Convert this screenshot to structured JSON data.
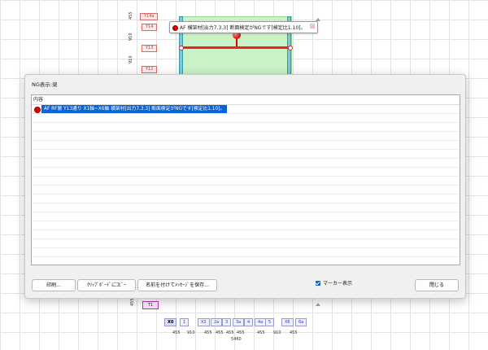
{
  "drawing": {
    "y_tags": [
      "Y14a",
      "Y14",
      "Y13",
      "Y12"
    ],
    "y_dims": [
      "910",
      "910"
    ],
    "left_dim": "455",
    "t1_label": "T1",
    "x_tags": [
      "X0",
      "1",
      "X2",
      "2a",
      "3",
      "3a",
      "4",
      "4a",
      "5",
      "X6",
      "6a"
    ],
    "x_dims": [
      "455",
      "910",
      "455",
      "455",
      "455",
      "455",
      "455",
      "910",
      "455"
    ],
    "x_total": "5460"
  },
  "tooltip": {
    "text": "AF 横架材[出力7.3.3] 断面検定がNGです[検定比1.10]。"
  },
  "dialog": {
    "title": "NG表示:梁",
    "column_header": "内容",
    "rows": [
      {
        "text": "AF RF層 Y13通り X1軸~X6軸 横架材[出力7.3.3] 断面検定がNGです[検定比1.10]。",
        "selected": true
      }
    ],
    "buttons": {
      "print": "印刷...",
      "copy": "ｸﾘｯﾌﾟﾎﾞｰﾄﾞにｺﾋﾟｰ",
      "save": "名前を付けてﾒｯｾｰｼﾞを保存...",
      "close": "閉じる"
    },
    "marker_checkbox": {
      "label": "マーカー表示",
      "checked": true
    }
  },
  "colors": {
    "accent": "#0a64d8",
    "ng_red": "#dd0000",
    "frame_fill": "#c9f2c6"
  }
}
